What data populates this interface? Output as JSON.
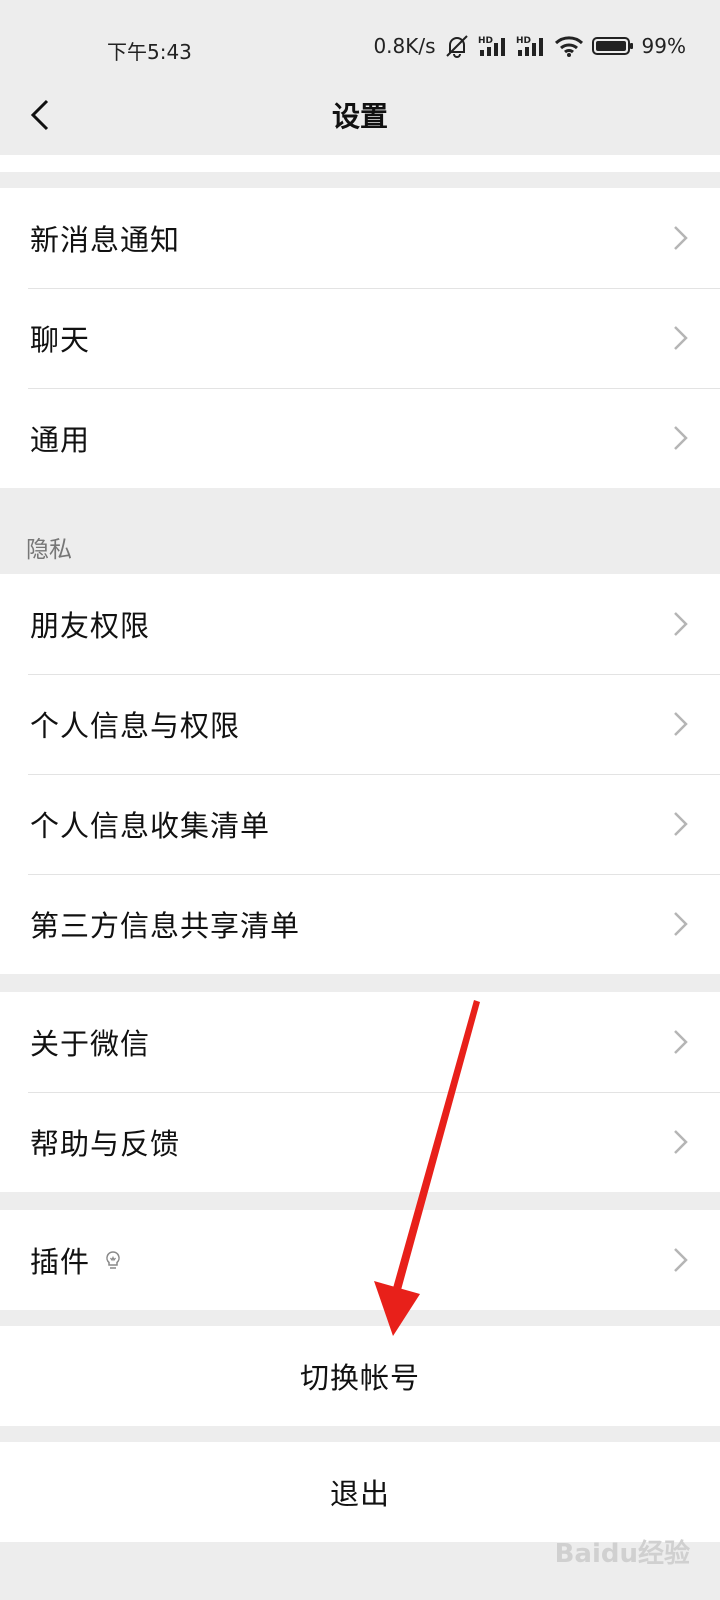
{
  "status_bar": {
    "time": "下午5:43",
    "speed": "0.8K/s",
    "battery": "99%"
  },
  "nav": {
    "title": "设置"
  },
  "group1": [
    {
      "label": "新消息通知"
    },
    {
      "label": "聊天"
    },
    {
      "label": "通用"
    }
  ],
  "privacy_section_title": "隐私",
  "group2": [
    {
      "label": "朋友权限"
    },
    {
      "label": "个人信息与权限"
    },
    {
      "label": "个人信息收集清单"
    },
    {
      "label": "第三方信息共享清单"
    }
  ],
  "group3": [
    {
      "label": "关于微信"
    },
    {
      "label": "帮助与反馈"
    }
  ],
  "group4": [
    {
      "label": "插件"
    }
  ],
  "switch_account": "切换帐号",
  "logout": "退出",
  "watermark": "Baidu经验",
  "colors": {
    "background": "#ededed",
    "arrow": "#e8201a"
  }
}
